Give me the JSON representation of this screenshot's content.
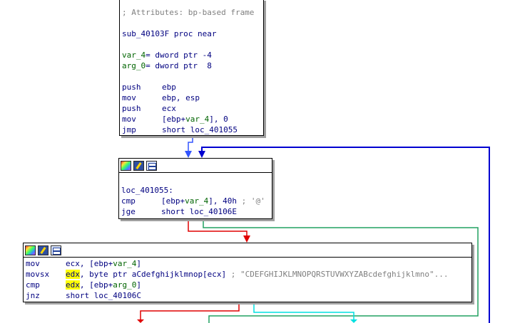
{
  "node1": {
    "comment": "; Attributes: bp-based frame",
    "proc": "sub_40103F proc near",
    "var4_name": "var_4",
    "var4_def": "= dword ptr -4",
    "arg0_name": "arg_0",
    "arg0_def": "= dword ptr  8",
    "instructions": [
      {
        "mnem": "push",
        "ops": "ebp"
      },
      {
        "mnem": "mov",
        "ops": "ebp, esp"
      },
      {
        "mnem": "push",
        "ops": "ecx"
      },
      {
        "mnem": "mov",
        "ops_a": "[ebp+",
        "ops_var": "var_4",
        "ops_b": "], 0"
      },
      {
        "mnem": "jmp",
        "ops": "short loc_401055"
      }
    ]
  },
  "node2": {
    "label": "loc_401055:",
    "cmp_mnem": "cmp",
    "cmp_a": "[ebp+",
    "cmp_var": "var_4",
    "cmp_b": "], 40h",
    "cmp_comment": " ; '@'",
    "jge_mnem": "jge",
    "jge_ops": "short loc_40106E"
  },
  "node3": {
    "l1_mnem": "mov",
    "l1_a": "ecx, [ebp+",
    "l1_var": "var_4",
    "l1_b": "]",
    "l2_mnem": "movsx",
    "l2_reg": "edx",
    "l2_a": ", byte ptr aCdefghijklmnop[ecx]",
    "l2_comment": " ; \"CDEFGHIJKLMNOPQRSTUVWXYZABcdefghijklmno\"...",
    "l3_mnem": "cmp",
    "l3_reg": "edx",
    "l3_a": ", [ebp+",
    "l3_var": "arg_0",
    "l3_b": "]",
    "l4_mnem": "jnz",
    "l4_ops": "short loc_40106C"
  },
  "colors": {
    "edge_normal": "#0000ff",
    "edge_loop": "#0000c8",
    "edge_true": "#00a040",
    "edge_false": "#e00000",
    "edge_cyan": "#00e0e0",
    "highlight": "#ffff00"
  }
}
